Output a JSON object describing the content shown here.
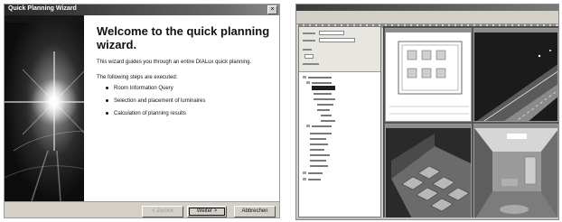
{
  "wizard": {
    "title": "Quick Planning Wizard",
    "close_symbol": "×",
    "heading": "Welcome to the quick planning wizard.",
    "intro": "This wizard guides you through an entire DIALux quick planning.",
    "steps_label": "The following steps are executed:",
    "steps": [
      "Room Information Query",
      "Selection and placement of luminaires",
      "Calculation of planning results"
    ],
    "buttons": {
      "back": "< Zurück",
      "next": "Weiter >",
      "cancel": "Abbrechen"
    },
    "image_icon": "light-flare-image"
  },
  "app": {
    "icons": {
      "tree": "project-tree-icon",
      "view": "render-view-icon"
    },
    "views": [
      "floor-plan",
      "3d-night-road",
      "3d-room-top",
      "3d-room-interior"
    ]
  }
}
